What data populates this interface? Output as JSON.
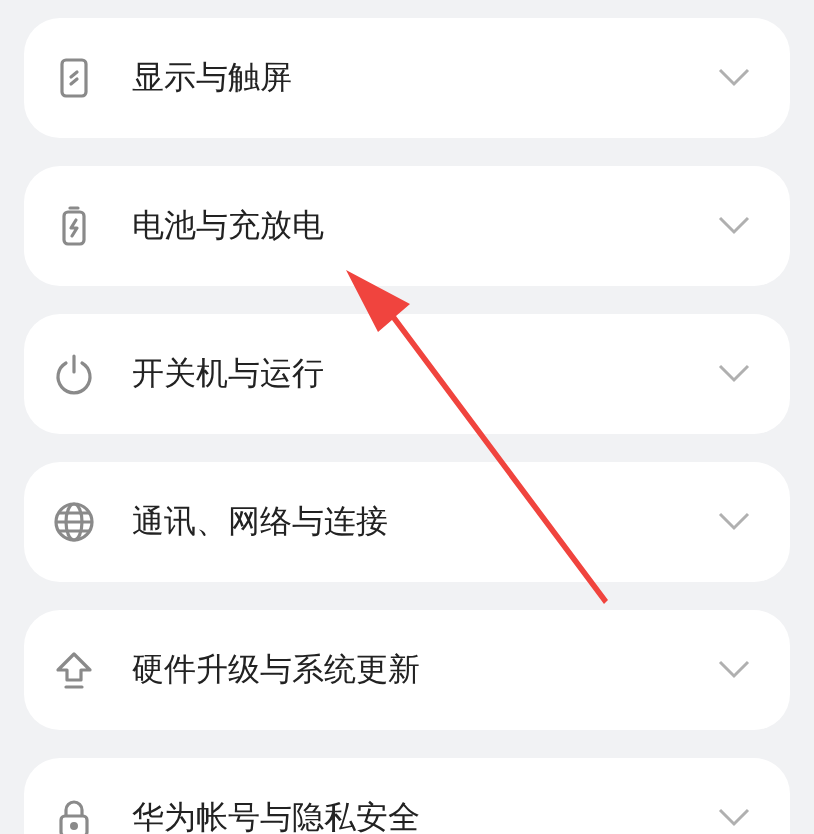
{
  "settings": [
    {
      "label": "显示与触屏",
      "kind": "display",
      "expanded": false
    },
    {
      "label": "电池与充放电",
      "kind": "battery",
      "expanded": false
    },
    {
      "label": "开关机与运行",
      "kind": "power",
      "expanded": false
    },
    {
      "label": "通讯、网络与连接",
      "kind": "globe",
      "expanded": false
    },
    {
      "label": "硬件升级与系统更新",
      "kind": "upgrade",
      "expanded": false
    },
    {
      "label": "华为帐号与隐私安全",
      "kind": "lock",
      "expanded": false
    }
  ],
  "annotation": {
    "kind": "arrow"
  }
}
